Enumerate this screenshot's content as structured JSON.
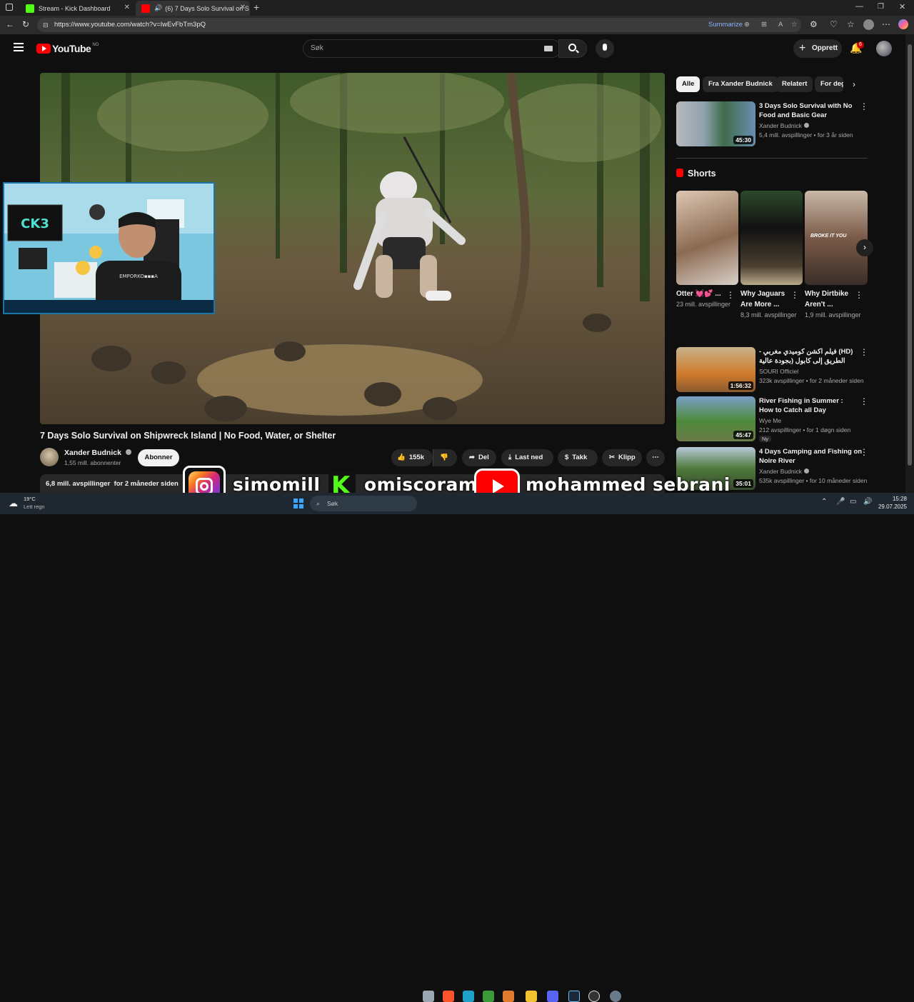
{
  "browser": {
    "tabs": [
      {
        "title": "Stream - Kick Dashboard",
        "icon": "kick-icon"
      },
      {
        "title": "(6) 7 Days Solo Survival on S",
        "icon": "youtube-icon"
      }
    ],
    "url": "https://www.youtube.com/watch?v=IwEvFbTm3pQ",
    "summarize_label": "Summarize"
  },
  "youtube": {
    "logo_text": "YouTube",
    "logo_region": "NO",
    "search_placeholder": "Søk",
    "create_label": "Opprett",
    "notifications_count": "6"
  },
  "video": {
    "title": "7 Days Solo Survival on Shipwreck Island | No Food, Water, or Shelter",
    "channel": "Xander Budnick",
    "subscribers": "1,55 mill. abonnenter",
    "subscribe_label": "Abonner",
    "likes": "155k",
    "share_label": "Del",
    "download_label": "Last ned",
    "thanks_label": "Takk",
    "clip_label": "Klipp",
    "description_meta": "6,8 mill. avspillinger  for 2 måneder siden"
  },
  "filters": [
    "Alle",
    "Fra Xander Budnick",
    "Relatert",
    "For deg"
  ],
  "recommendations": [
    {
      "title": "3 Days Solo Survival with No Food and Basic Gear",
      "channel": "Xander Budnick",
      "meta": "5,4 mill. avspillinger • for 3 år siden",
      "duration": "45:30",
      "verified": true
    },
    {
      "title": "(HD) فيلم اكشن كوميدي مغربي - الطريق إلى كابول (بجودة عالية",
      "channel": "SOURI Officiel",
      "meta": "323k avspillinger • for 2 måneder siden",
      "duration": "1:56:32",
      "verified": false
    },
    {
      "title": "River Fishing in Summer : How to Catch all Day",
      "channel": "Wye Me",
      "meta": "212 avspillinger • for 1 døgn siden",
      "badge": "Ny",
      "duration": "45:47",
      "verified": false
    },
    {
      "title": "4 Days Camping and Fishing on Noire River",
      "channel": "Xander Budnick",
      "meta": "535k avspillinger • for 10 måneder siden",
      "duration": "35:01",
      "verified": true
    }
  ],
  "shorts": {
    "heading": "Shorts",
    "items": [
      {
        "title": "Otter 💓💕 ...",
        "views": "23 mill. avspillinger"
      },
      {
        "title": "Why Jaguars Are More ...",
        "views": "8,3 mill. avspillinger"
      },
      {
        "title": "Why Dirtbike Aren't ...",
        "views": "1,9 mill. avspillinger"
      }
    ],
    "short_captions": [
      "BROKE IT YOU"
    ]
  },
  "overlay": {
    "instagram": "simomill",
    "kick": "omiscoram",
    "youtube": "mohammed sebrani"
  },
  "taskbar": {
    "temperature": "19°C",
    "weather": "Lett regn",
    "search": "Søk",
    "time": "15:28",
    "date": "29.07.2025"
  },
  "colors": {
    "yt_red": "#ff0000",
    "kick_green": "#53fc18",
    "bg": "#0f0f0f"
  }
}
